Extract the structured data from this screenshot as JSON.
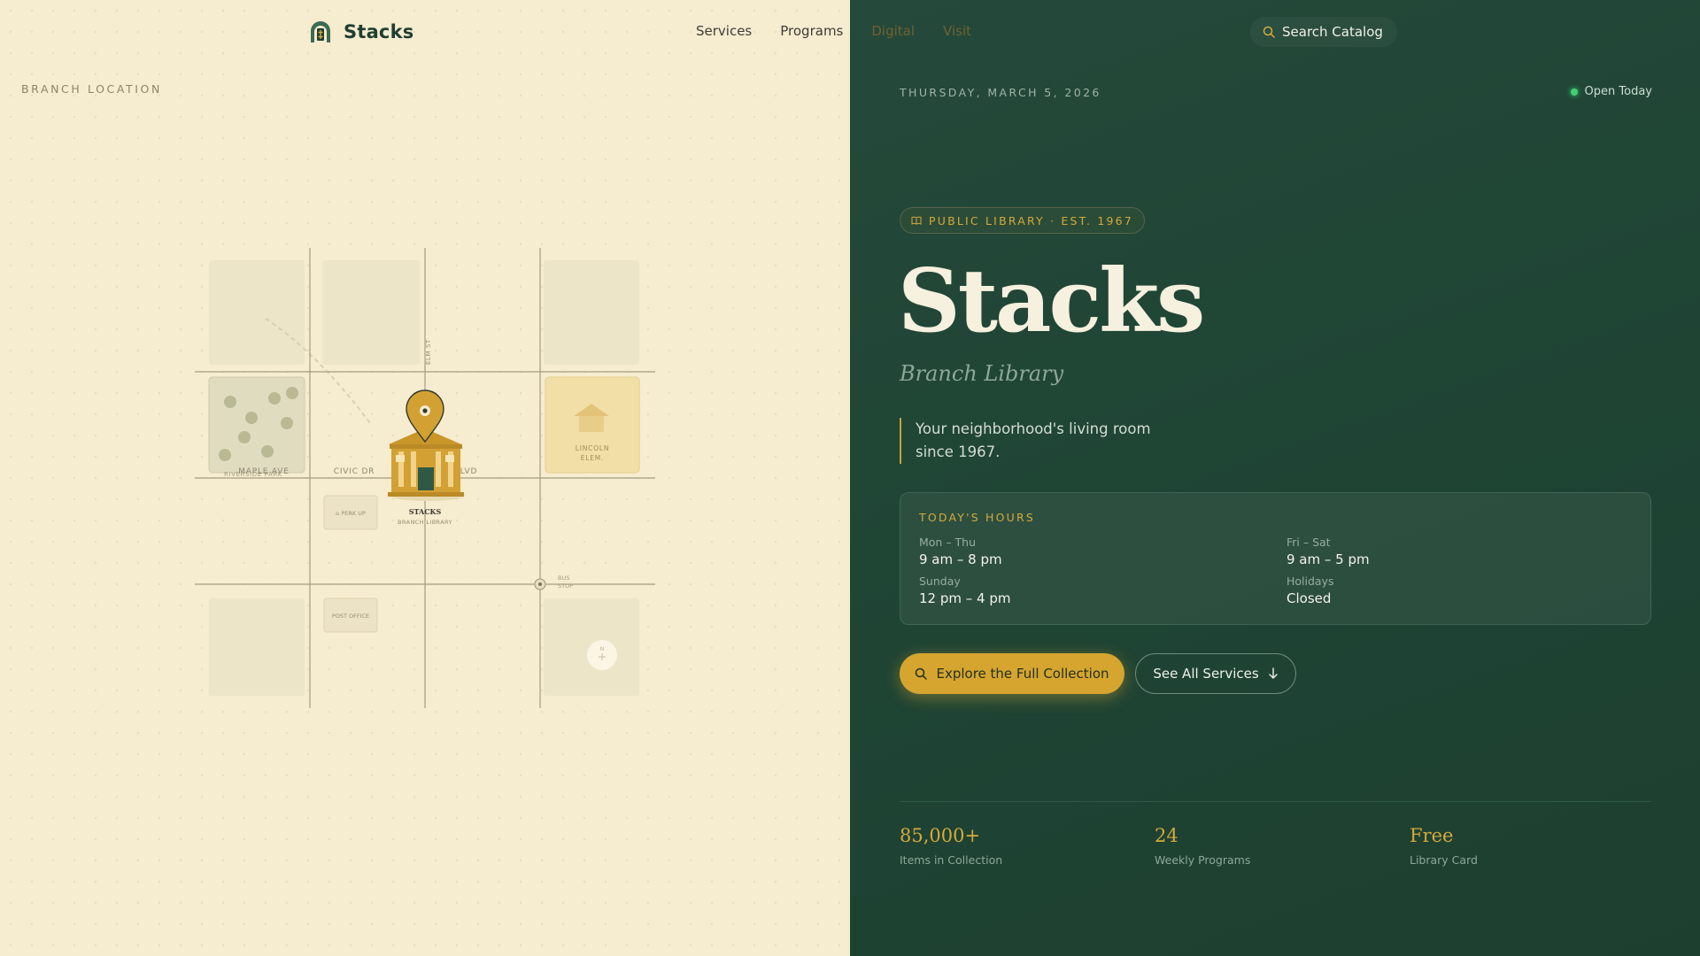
{
  "brand": {
    "name": "Stacks"
  },
  "nav": {
    "items": [
      "Services",
      "Programs",
      "Digital",
      "Visit"
    ]
  },
  "search": {
    "label": "Search Catalog"
  },
  "map": {
    "section_label": "BRANCH LOCATION",
    "streets": {
      "elm": "ELM ST",
      "maple": "MAPLE AVE",
      "civic": "CIVIC DR",
      "blvd": "BLVD"
    },
    "places": {
      "park": "RIVERSIDE PARK",
      "school_line1": "LINCOLN",
      "school_line2": "ELEM.",
      "library_name": "STACKS",
      "library_sub": "BRANCH LIBRARY",
      "parking": "⌂ PERK UP",
      "post_office": "POST OFFICE",
      "bus_line1": "BUS",
      "bus_line2": "STOP",
      "compass": "N"
    }
  },
  "date": "THURSDAY, MARCH 5, 2026",
  "status": "Open Today",
  "badge": "PUBLIC LIBRARY · EST. 1967",
  "title": "Stacks",
  "subtitle": "Branch Library",
  "tagline": "Your neighborhood's living room since 1967.",
  "hours": {
    "heading": "TODAY'S HOURS",
    "rows": [
      {
        "label": "Mon – Thu",
        "value": "9 am – 8 pm"
      },
      {
        "label": "Fri – Sat",
        "value": "9 am – 5 pm"
      },
      {
        "label": "Sunday",
        "value": "12 pm – 4 pm"
      },
      {
        "label": "Holidays",
        "value": "Closed"
      }
    ]
  },
  "actions": {
    "primary": "Explore the Full Collection",
    "secondary": "See All Services"
  },
  "stats": [
    {
      "value": "85,000+",
      "label": "Items in Collection"
    },
    {
      "value": "24",
      "label": "Weekly Programs"
    },
    {
      "value": "Free",
      "label": "Library Card"
    }
  ],
  "colors": {
    "accent": "#d6a52f",
    "forest": "#1f4535",
    "cream": "#f6ecd0",
    "open": "#3ecf73"
  }
}
